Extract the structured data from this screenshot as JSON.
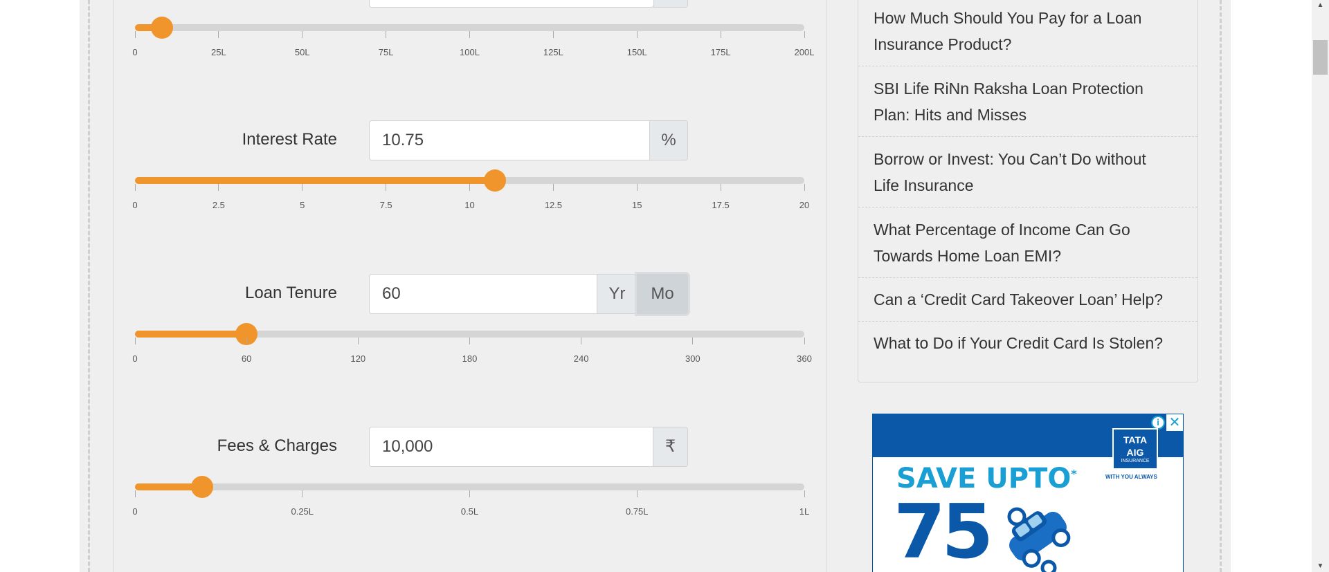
{
  "colors": {
    "accent": "#f0952c",
    "track": "#d5d5d5",
    "panel_bg": "#efefef"
  },
  "loan_amount_slider": {
    "value_lakh": 8,
    "min": 0,
    "max": 200,
    "ticks": [
      "0",
      "25L",
      "50L",
      "75L",
      "100L",
      "125L",
      "150L",
      "175L",
      "200L"
    ]
  },
  "interest_rate": {
    "label": "Interest Rate",
    "value": "10.75",
    "unit": "%",
    "slider": {
      "value": 10.75,
      "min": 0,
      "max": 20,
      "ticks": [
        "0",
        "2.5",
        "5",
        "7.5",
        "10",
        "12.5",
        "15",
        "17.5",
        "20"
      ]
    }
  },
  "loan_tenure": {
    "label": "Loan Tenure",
    "value": "60",
    "unit_year": "Yr",
    "unit_month": "Mo",
    "active_unit": "Mo",
    "slider": {
      "value": 60,
      "min": 0,
      "max": 360,
      "ticks": [
        "0",
        "60",
        "120",
        "180",
        "240",
        "300",
        "360"
      ]
    }
  },
  "fees_charges": {
    "label": "Fees & Charges",
    "value": "10,000",
    "unit": "₹",
    "slider": {
      "value_fraction": 0.1,
      "ticks": [
        "0",
        "0.25L",
        "0.5L",
        "0.75L",
        "1L"
      ]
    }
  },
  "sidebar": {
    "articles": [
      {
        "line1": "How Much Should You Pay for a Loan",
        "line2": "Insurance Product?"
      },
      {
        "line1": "SBI Life RiNn Raksha Loan Protection",
        "line2": "Plan: Hits and Misses"
      },
      {
        "line1": "Borrow or Invest: You Can’t Do without",
        "line2": "Life Insurance"
      },
      {
        "line1": "What Percentage of Income Can Go",
        "line2": "Towards Home Loan EMI?"
      },
      {
        "line1": "Can a ‘Credit Card Takeover Loan’ Help?",
        "line2": ""
      },
      {
        "line1": "What to Do if Your Credit Card Is Stolen?",
        "line2": ""
      }
    ]
  },
  "ad": {
    "logo_top": "TATA",
    "logo_mid": "AIG",
    "logo_bottom": "INSURANCE",
    "tagline": "WITH YOU ALWAYS",
    "headline": "SAVE UPTO",
    "headline_mark": "*",
    "big_number": "75",
    "info_icon": "i",
    "close_icon": "✕"
  }
}
